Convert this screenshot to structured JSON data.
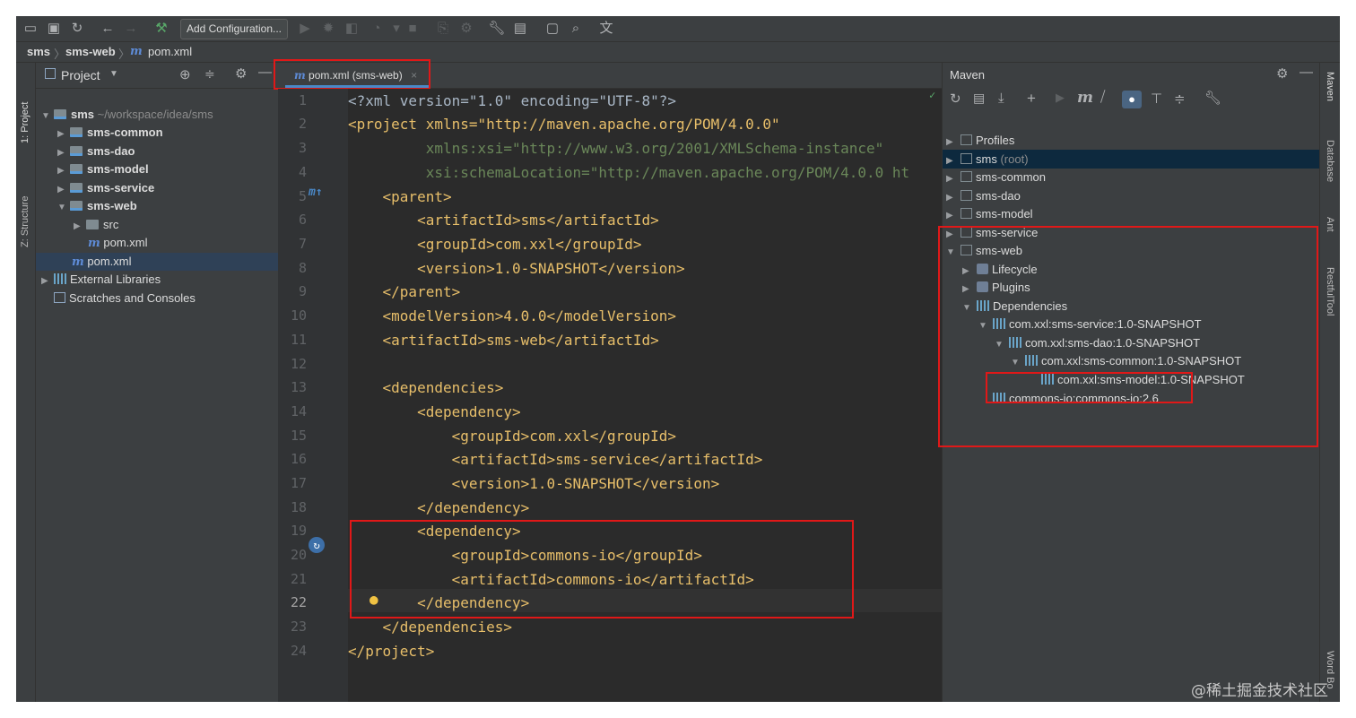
{
  "toolbar": {
    "add_config_label": "Add Configuration..."
  },
  "breadcrumb": {
    "items": [
      "sms",
      "sms-web",
      "pom.xml"
    ]
  },
  "left_stripe": {
    "project_label": "1: Project",
    "structure_label": "Z: Structure"
  },
  "right_stripe": {
    "maven_label": "Maven",
    "database_label": "Database",
    "ant_label": "Ant",
    "restful_label": "RestfulTool",
    "wordbook_label": "Word Bo"
  },
  "project_panel": {
    "title": "Project",
    "tree": [
      {
        "label": "sms",
        "hint": "~/workspace/idea/sms"
      },
      {
        "label": "sms-common"
      },
      {
        "label": "sms-dao"
      },
      {
        "label": "sms-model"
      },
      {
        "label": "sms-service"
      },
      {
        "label": "sms-web"
      },
      {
        "label": "src"
      },
      {
        "label": "pom.xml"
      },
      {
        "label": "pom.xml"
      },
      {
        "label": "External Libraries"
      },
      {
        "label": "Scratches and Consoles"
      }
    ]
  },
  "editor": {
    "tab_label": "pom.xml (sms-web)",
    "line_numbers": [
      "1",
      "2",
      "3",
      "4",
      "5",
      "6",
      "7",
      "8",
      "9",
      "10",
      "11",
      "12",
      "13",
      "14",
      "15",
      "16",
      "17",
      "18",
      "19",
      "20",
      "21",
      "22",
      "23",
      "24"
    ],
    "lines": [
      "<?xml version=\"1.0\" encoding=\"UTF-8\"?>",
      "<project xmlns=\"http://maven.apache.org/POM/4.0.0\"",
      "         xmlns:xsi=\"http://www.w3.org/2001/XMLSchema-instance\"",
      "         xsi:schemaLocation=\"http://maven.apache.org/POM/4.0.0 ht",
      "    <parent>",
      "        <artifactId>sms</artifactId>",
      "        <groupId>com.xxl</groupId>",
      "        <version>1.0-SNAPSHOT</version>",
      "    </parent>",
      "    <modelVersion>4.0.0</modelVersion>",
      "    <artifactId>sms-web</artifactId>",
      "",
      "    <dependencies>",
      "        <dependency>",
      "            <groupId>com.xxl</groupId>",
      "            <artifactId>sms-service</artifactId>",
      "            <version>1.0-SNAPSHOT</version>",
      "        </dependency>",
      "        <dependency>",
      "            <groupId>commons-io</groupId>",
      "            <artifactId>commons-io</artifactId>",
      "        </dependency>",
      "    </dependencies>",
      "</project>"
    ]
  },
  "maven": {
    "title": "Maven",
    "tree": [
      {
        "label": "Profiles"
      },
      {
        "label": "sms",
        "hint": "(root)"
      },
      {
        "label": "sms-common"
      },
      {
        "label": "sms-dao"
      },
      {
        "label": "sms-model"
      },
      {
        "label": "sms-service"
      },
      {
        "label": "sms-web"
      },
      {
        "label": "Lifecycle"
      },
      {
        "label": "Plugins"
      },
      {
        "label": "Dependencies"
      },
      {
        "label": "com.xxl:sms-service:1.0-SNAPSHOT"
      },
      {
        "label": "com.xxl:sms-dao:1.0-SNAPSHOT"
      },
      {
        "label": "com.xxl:sms-common:1.0-SNAPSHOT"
      },
      {
        "label": "com.xxl:sms-model:1.0-SNAPSHOT"
      },
      {
        "label": "commons-io:commons-io:2.6"
      }
    ]
  },
  "watermark": "@稀土掘金技术社区"
}
